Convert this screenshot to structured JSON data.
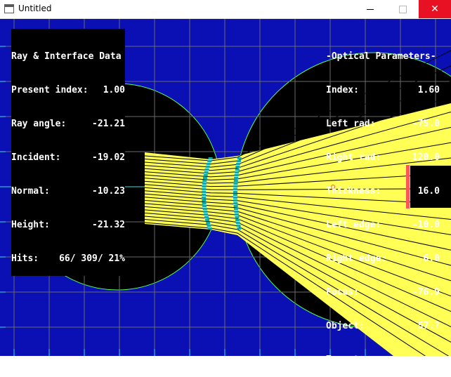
{
  "window": {
    "title": "Untitled",
    "minimize_glyph": "minimize-icon",
    "maximize_glyph": "maximize-icon",
    "close_glyph": "✕"
  },
  "colors": {
    "background": "#0a10b4",
    "lens_fill": "#000000",
    "ray_band": "#ffff55",
    "interface_hits": "#13a8a8",
    "axis": "#36e0e0",
    "grid": "#6a6a6a",
    "circle_outline": "#55ff55",
    "target_bar": "#ff5555"
  },
  "ray_data": {
    "title": "Ray & Interface Data",
    "present_index": {
      "label": "Present index:",
      "value": "1.00"
    },
    "ray_angle": {
      "label": "Ray angle:",
      "value": "-21.21"
    },
    "incident": {
      "label": "Incident:",
      "value": "-19.02"
    },
    "normal": {
      "label": "Normal:",
      "value": "-10.23"
    },
    "height": {
      "label": "Height:",
      "value": "-21.32"
    },
    "hits": {
      "label": "Hits:",
      "value": "66/ 309/ 21%"
    }
  },
  "optical": {
    "title": "-Optical Parameters-",
    "index": {
      "label": "Index:",
      "value": "1.60"
    },
    "left_rad": {
      "label": "Left rad:",
      "value": "-75.0"
    },
    "right_rad": {
      "label": "Right rad:",
      "value": "120.0"
    },
    "thickness": {
      "label": "Thickness:",
      "value": "16.0"
    },
    "left_edge": {
      "label": "Left edge:",
      "value": "-10.0"
    },
    "right_edge": {
      "label": "Right edge:",
      "value": "6.0"
    },
    "focus": {
      "label": "Focus:",
      "value": "-76.9"
    },
    "object": {
      "label": "Object:",
      "value": "57.?"
    },
    "target": {
      "label": "Target:",
      "value": ""
    }
  }
}
